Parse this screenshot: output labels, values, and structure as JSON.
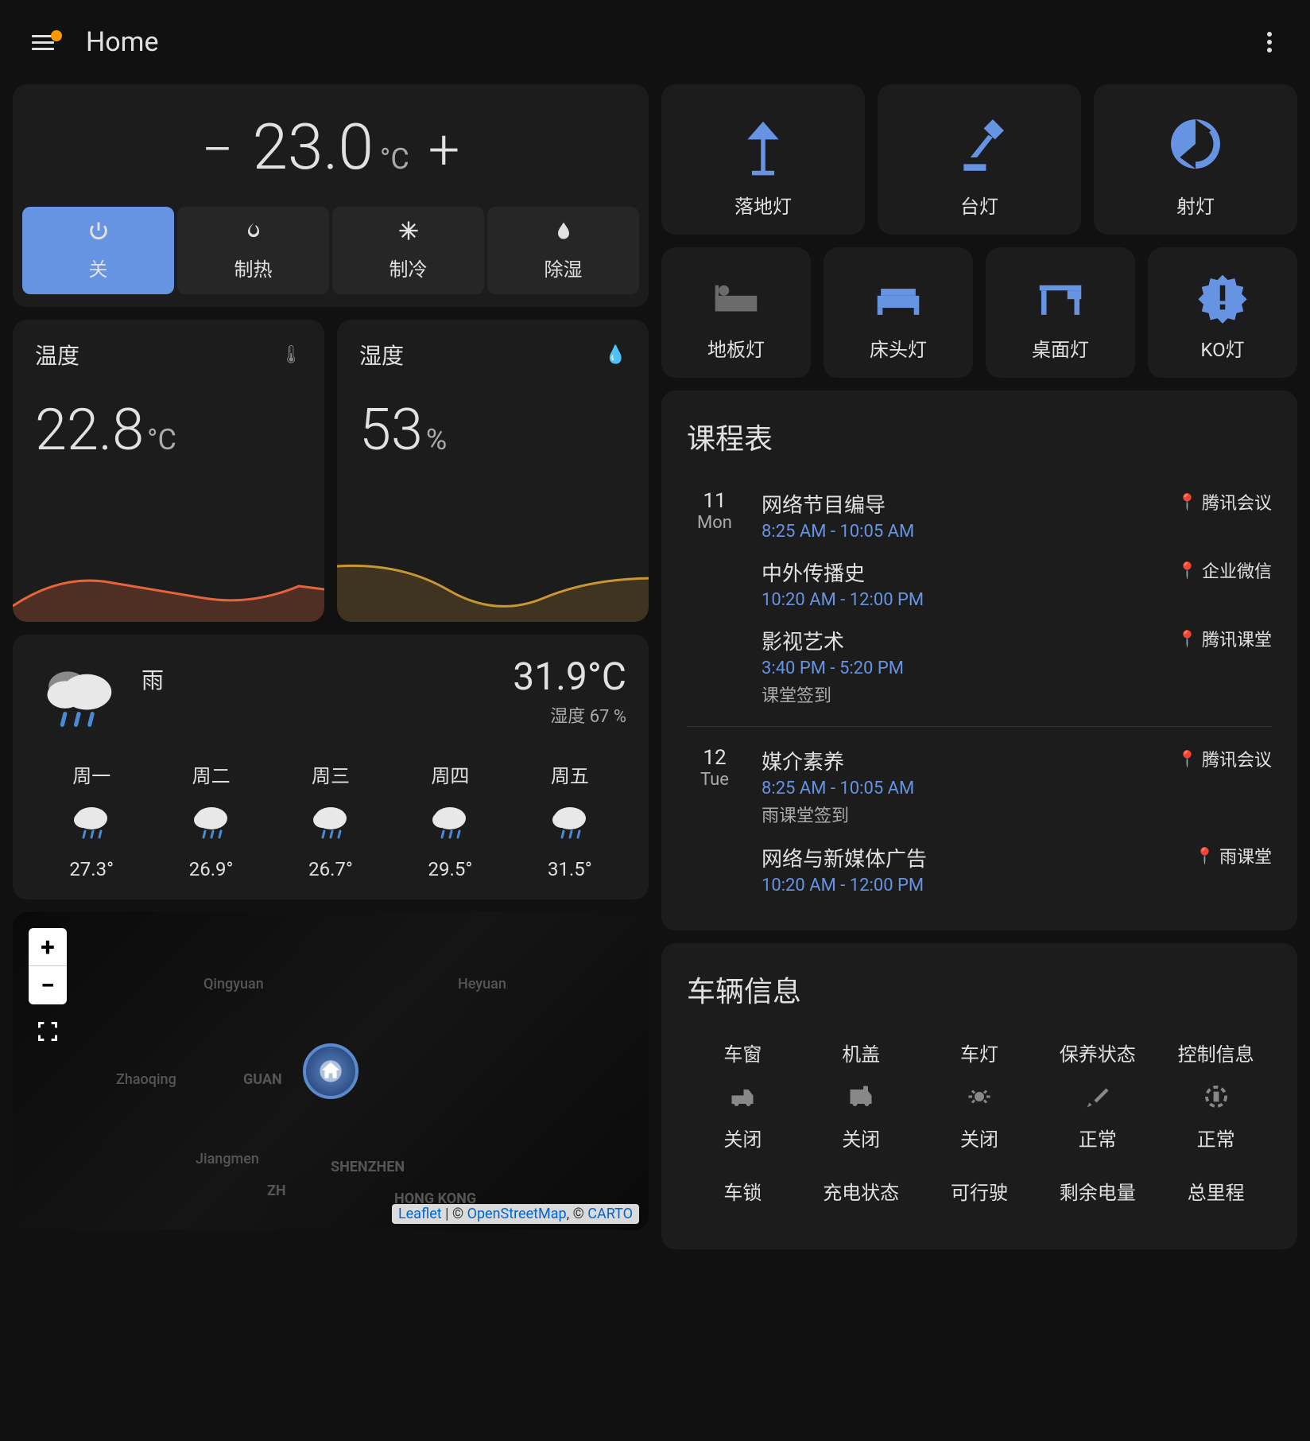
{
  "header": {
    "title": "Home"
  },
  "thermostat": {
    "value": "23.0",
    "unit": "°C",
    "modes": [
      {
        "label": "关",
        "icon": "power",
        "active": true
      },
      {
        "label": "制热",
        "icon": "fire",
        "active": false
      },
      {
        "label": "制冷",
        "icon": "snowflake",
        "active": false
      },
      {
        "label": "除湿",
        "icon": "droplet",
        "active": false
      }
    ]
  },
  "sensors": {
    "temperature": {
      "title": "温度",
      "value": "22.8",
      "unit": "°C"
    },
    "humidity": {
      "title": "湿度",
      "value": "53",
      "unit": "%"
    }
  },
  "weather": {
    "condition": "雨",
    "temp": "31.9°C",
    "humidity_label": "湿度 67 %",
    "forecast": [
      {
        "day": "周一",
        "temp": "27.3°"
      },
      {
        "day": "周二",
        "temp": "26.9°"
      },
      {
        "day": "周三",
        "temp": "26.7°"
      },
      {
        "day": "周四",
        "temp": "29.5°"
      },
      {
        "day": "周五",
        "temp": "31.5°"
      }
    ]
  },
  "map": {
    "attr_leaflet": "Leaflet",
    "attr_sep1": " | © ",
    "attr_osm": "OpenStreetMap",
    "attr_sep2": ", © ",
    "attr_carto": "CARTO",
    "labels": [
      "Qingyuan",
      "Heyuan",
      "Zhaoqing",
      "GUAN",
      "Jiangmen",
      "SHENZHEN",
      "ZH",
      "HONG KONG"
    ]
  },
  "lights": {
    "row1": [
      {
        "name": "落地灯",
        "icon": "floor-lamp",
        "on": true
      },
      {
        "name": "台灯",
        "icon": "desk-lamp",
        "on": true
      },
      {
        "name": "射灯",
        "icon": "spotlight",
        "on": true
      }
    ],
    "row2": [
      {
        "name": "地板灯",
        "icon": "bed",
        "on": false
      },
      {
        "name": "床头灯",
        "icon": "couch",
        "on": true
      },
      {
        "name": "桌面灯",
        "icon": "desk",
        "on": true
      },
      {
        "name": "KO灯",
        "icon": "alert",
        "on": true
      }
    ]
  },
  "schedule": {
    "title": "课程表",
    "days": [
      {
        "date": "11",
        "dow": "Mon",
        "events": [
          {
            "title": "网络节目编导",
            "time": "8:25 AM - 10:05 AM",
            "loc": "腾讯会议"
          },
          {
            "title": "中外传播史",
            "time": "10:20 AM - 12:00 PM",
            "loc": "企业微信"
          },
          {
            "title": "影视艺术",
            "time": "3:40 PM - 5:20 PM",
            "loc": "腾讯课堂",
            "note": "课堂签到"
          }
        ]
      },
      {
        "date": "12",
        "dow": "Tue",
        "events": [
          {
            "title": "媒介素养",
            "time": "8:25 AM - 10:05 AM",
            "loc": "腾讯会议",
            "note": "雨课堂签到"
          },
          {
            "title": "网络与新媒体广告",
            "time": "10:20 AM - 12:00 PM",
            "loc": "雨课堂"
          }
        ]
      }
    ]
  },
  "vehicle": {
    "title": "车辆信息",
    "row1": [
      {
        "label": "车窗",
        "value": "关闭"
      },
      {
        "label": "机盖",
        "value": "关闭"
      },
      {
        "label": "车灯",
        "value": "关闭"
      },
      {
        "label": "保养状态",
        "value": "正常"
      },
      {
        "label": "控制信息",
        "value": "正常"
      }
    ],
    "row2_labels": [
      "车锁",
      "充电状态",
      "可行驶",
      "剩余电量",
      "总里程"
    ]
  }
}
